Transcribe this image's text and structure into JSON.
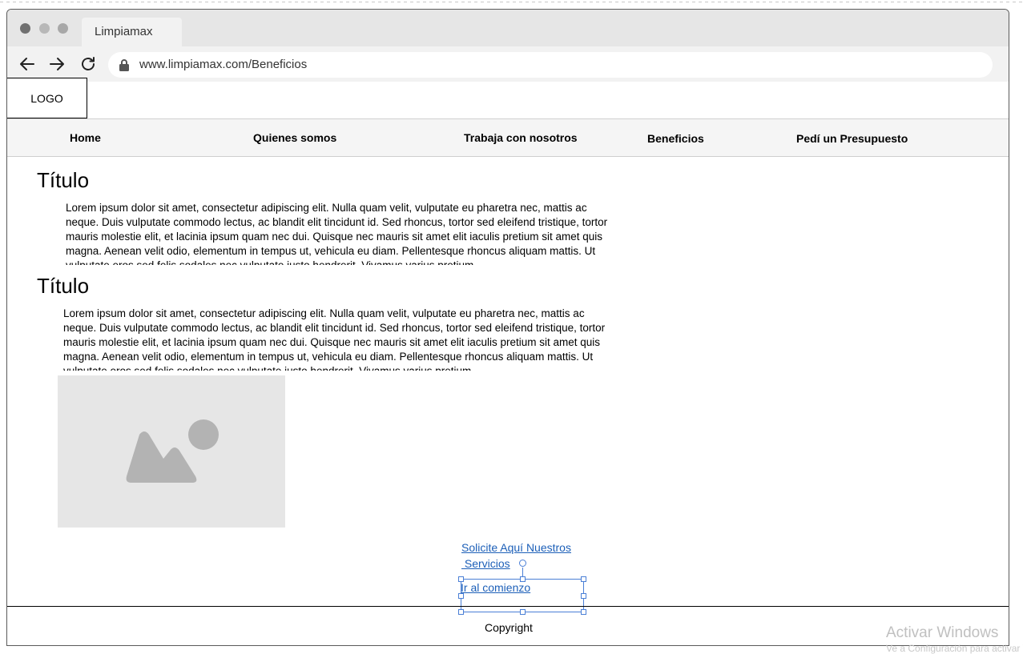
{
  "browser": {
    "tab_title": "Limpiamax",
    "url": "www.limpiamax.com/Beneficios"
  },
  "site": {
    "logo": "LOGO",
    "menu": [
      {
        "label": "Home"
      },
      {
        "label": "Quienes somos"
      },
      {
        "label": "Trabaja con nosotros"
      },
      {
        "label": "Beneficios"
      },
      {
        "label": "Pedí un Presupuesto"
      }
    ]
  },
  "content": {
    "sections": [
      {
        "title": "Título",
        "body": "Lorem ipsum dolor sit amet, consectetur adipiscing elit. Nulla quam velit, vulputate eu pharetra nec, mattis ac neque. Duis vulputate commodo lectus, ac blandit elit tincidunt id. Sed rhoncus, tortor sed eleifend tristique, tortor mauris molestie elit, et lacinia ipsum quam nec dui. Quisque nec mauris sit amet elit iaculis pretium sit amet quis magna. Aenean velit odio, elementum in tempus ut, vehicula eu diam. Pellentesque rhoncus aliquam mattis. Ut vulputate eros sed felis sodales nec vulputate justo hendrerit. Vivamus varius pretium"
      },
      {
        "title": "Título",
        "body": "Lorem ipsum dolor sit amet, consectetur adipiscing elit. Nulla quam velit, vulputate eu pharetra nec, mattis ac neque. Duis vulputate commodo lectus, ac blandit elit tincidunt id. Sed rhoncus, tortor sed eleifend tristique, tortor mauris molestie elit, et lacinia ipsum quam nec dui. Quisque nec mauris sit amet elit iaculis pretium sit amet quis magna. Aenean velit odio, elementum in tempus ut, vehicula eu diam. Pellentesque rhoncus aliquam mattis. Ut vulputate eros sed felis sodales nec vulputate justo hendrerit. Vivamus varius pretium"
      }
    ],
    "image_icon": "image-placeholder-icon"
  },
  "links": {
    "services_line1": "Solicite Aquí Nuestros",
    "services_line2": " Servicios",
    "go_top": "Ir al comienzo"
  },
  "footer": {
    "copyright": "Copyright"
  },
  "os": {
    "watermark": "Activar Windows",
    "watermark_sub": "Ve a Configuración para activar Windows."
  },
  "colors": {
    "link": "#1c5fb8",
    "selection": "#4a7fd6",
    "placeholder": "#e6e6e6",
    "placeholder_icon": "#b3b3b3"
  }
}
